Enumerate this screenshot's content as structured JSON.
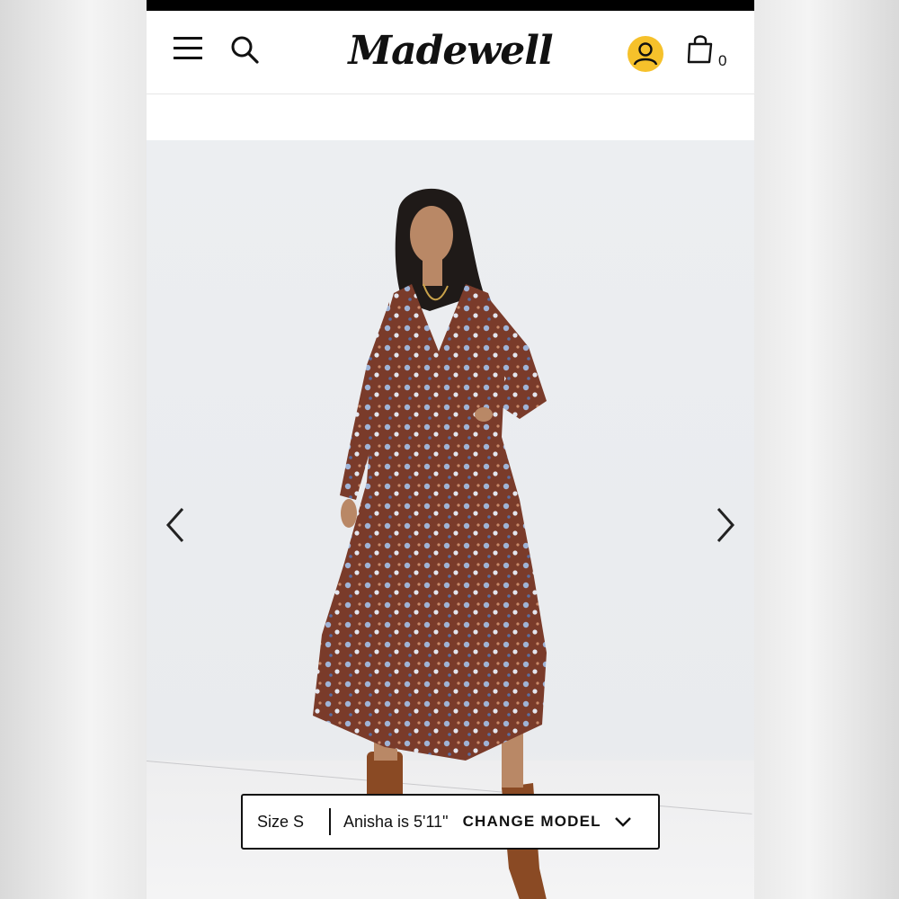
{
  "brand": {
    "logo_text": "Madewell"
  },
  "header": {
    "menu_icon": "hamburger-menu-icon",
    "search_icon": "search-icon",
    "account_icon": "user-account-icon",
    "account_color": "#f6c12b",
    "bag_icon": "shopping-bag-icon",
    "bag_count": "0"
  },
  "gallery": {
    "prev_icon": "chevron-left-icon",
    "next_icon": "chevron-right-icon",
    "dress_color": "#7a3b2a",
    "boot_color": "#8a4a24"
  },
  "model_bar": {
    "size_label": "Size S",
    "model_info": "Anisha is 5'11\"",
    "change_label": "CHANGE MODEL",
    "chevron_icon": "chevron-down-icon"
  }
}
